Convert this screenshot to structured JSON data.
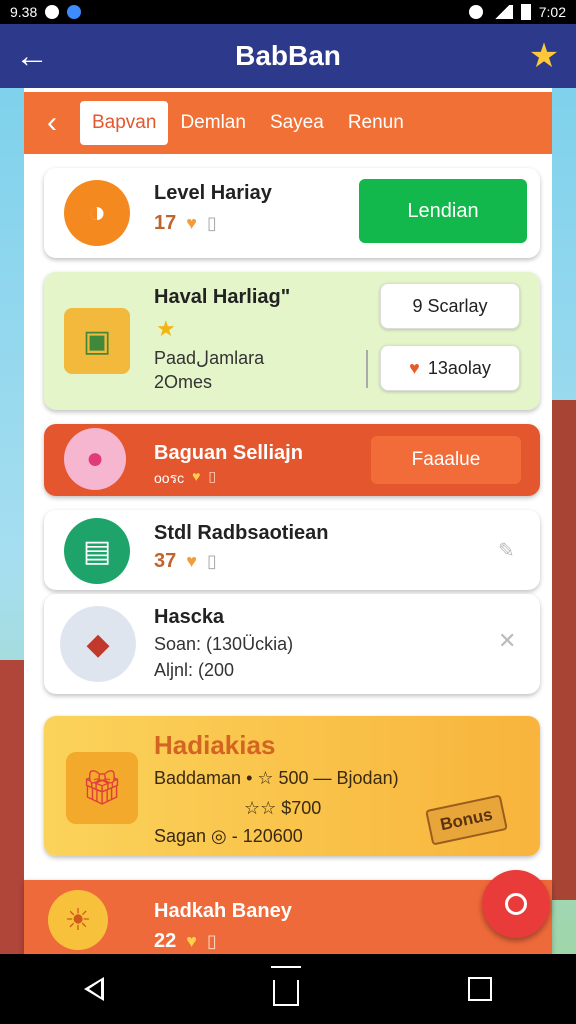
{
  "status": {
    "time_left": "9.38",
    "time_right": "7:02"
  },
  "app": {
    "title": "BabBan"
  },
  "tabs": [
    {
      "label": "Bapvan",
      "active": true
    },
    {
      "label": "Demlan",
      "active": false
    },
    {
      "label": "Sayea",
      "active": false
    },
    {
      "label": "Renun",
      "active": false
    }
  ],
  "cards": {
    "level": {
      "title": "Level Hariay",
      "count": "17",
      "button": "Lendian"
    },
    "haval": {
      "title": "Haval Harliag\"",
      "sub1": "Paadلamlara",
      "sub2": "2Omes",
      "btn1": "9 Scarlay",
      "btn2": "13aolay"
    },
    "bagan": {
      "title": "Baguan Selliajn",
      "sub": "ooรc",
      "button": "Faaalue"
    },
    "stdl": {
      "title": "Stdl Radbsaotiean",
      "count": "37"
    },
    "hascka": {
      "title": "Hascka",
      "line1": "Soan: (130Ückia)",
      "line2": "Aljnl: (200"
    },
    "promo": {
      "title": "Hadiakias",
      "line1": "Baddaman • ☆ 500 — Bjodan)",
      "line2": "☆☆ $700",
      "line3": "Sagan ◎ - 120600",
      "badge": "Bonus"
    },
    "bottom": {
      "title": "Hadkah Baney",
      "count": "22"
    }
  },
  "colors": {
    "appbar": "#2d3a8c",
    "tabbar": "#f07035",
    "green": "#12b84b",
    "orange": "#f26c3a"
  },
  "icons": [
    "back-arrow-icon",
    "star-badge-icon",
    "chevron-left-icon",
    "heart-icon",
    "trophy-icon",
    "pencil-icon",
    "close-icon",
    "fab-icon"
  ]
}
